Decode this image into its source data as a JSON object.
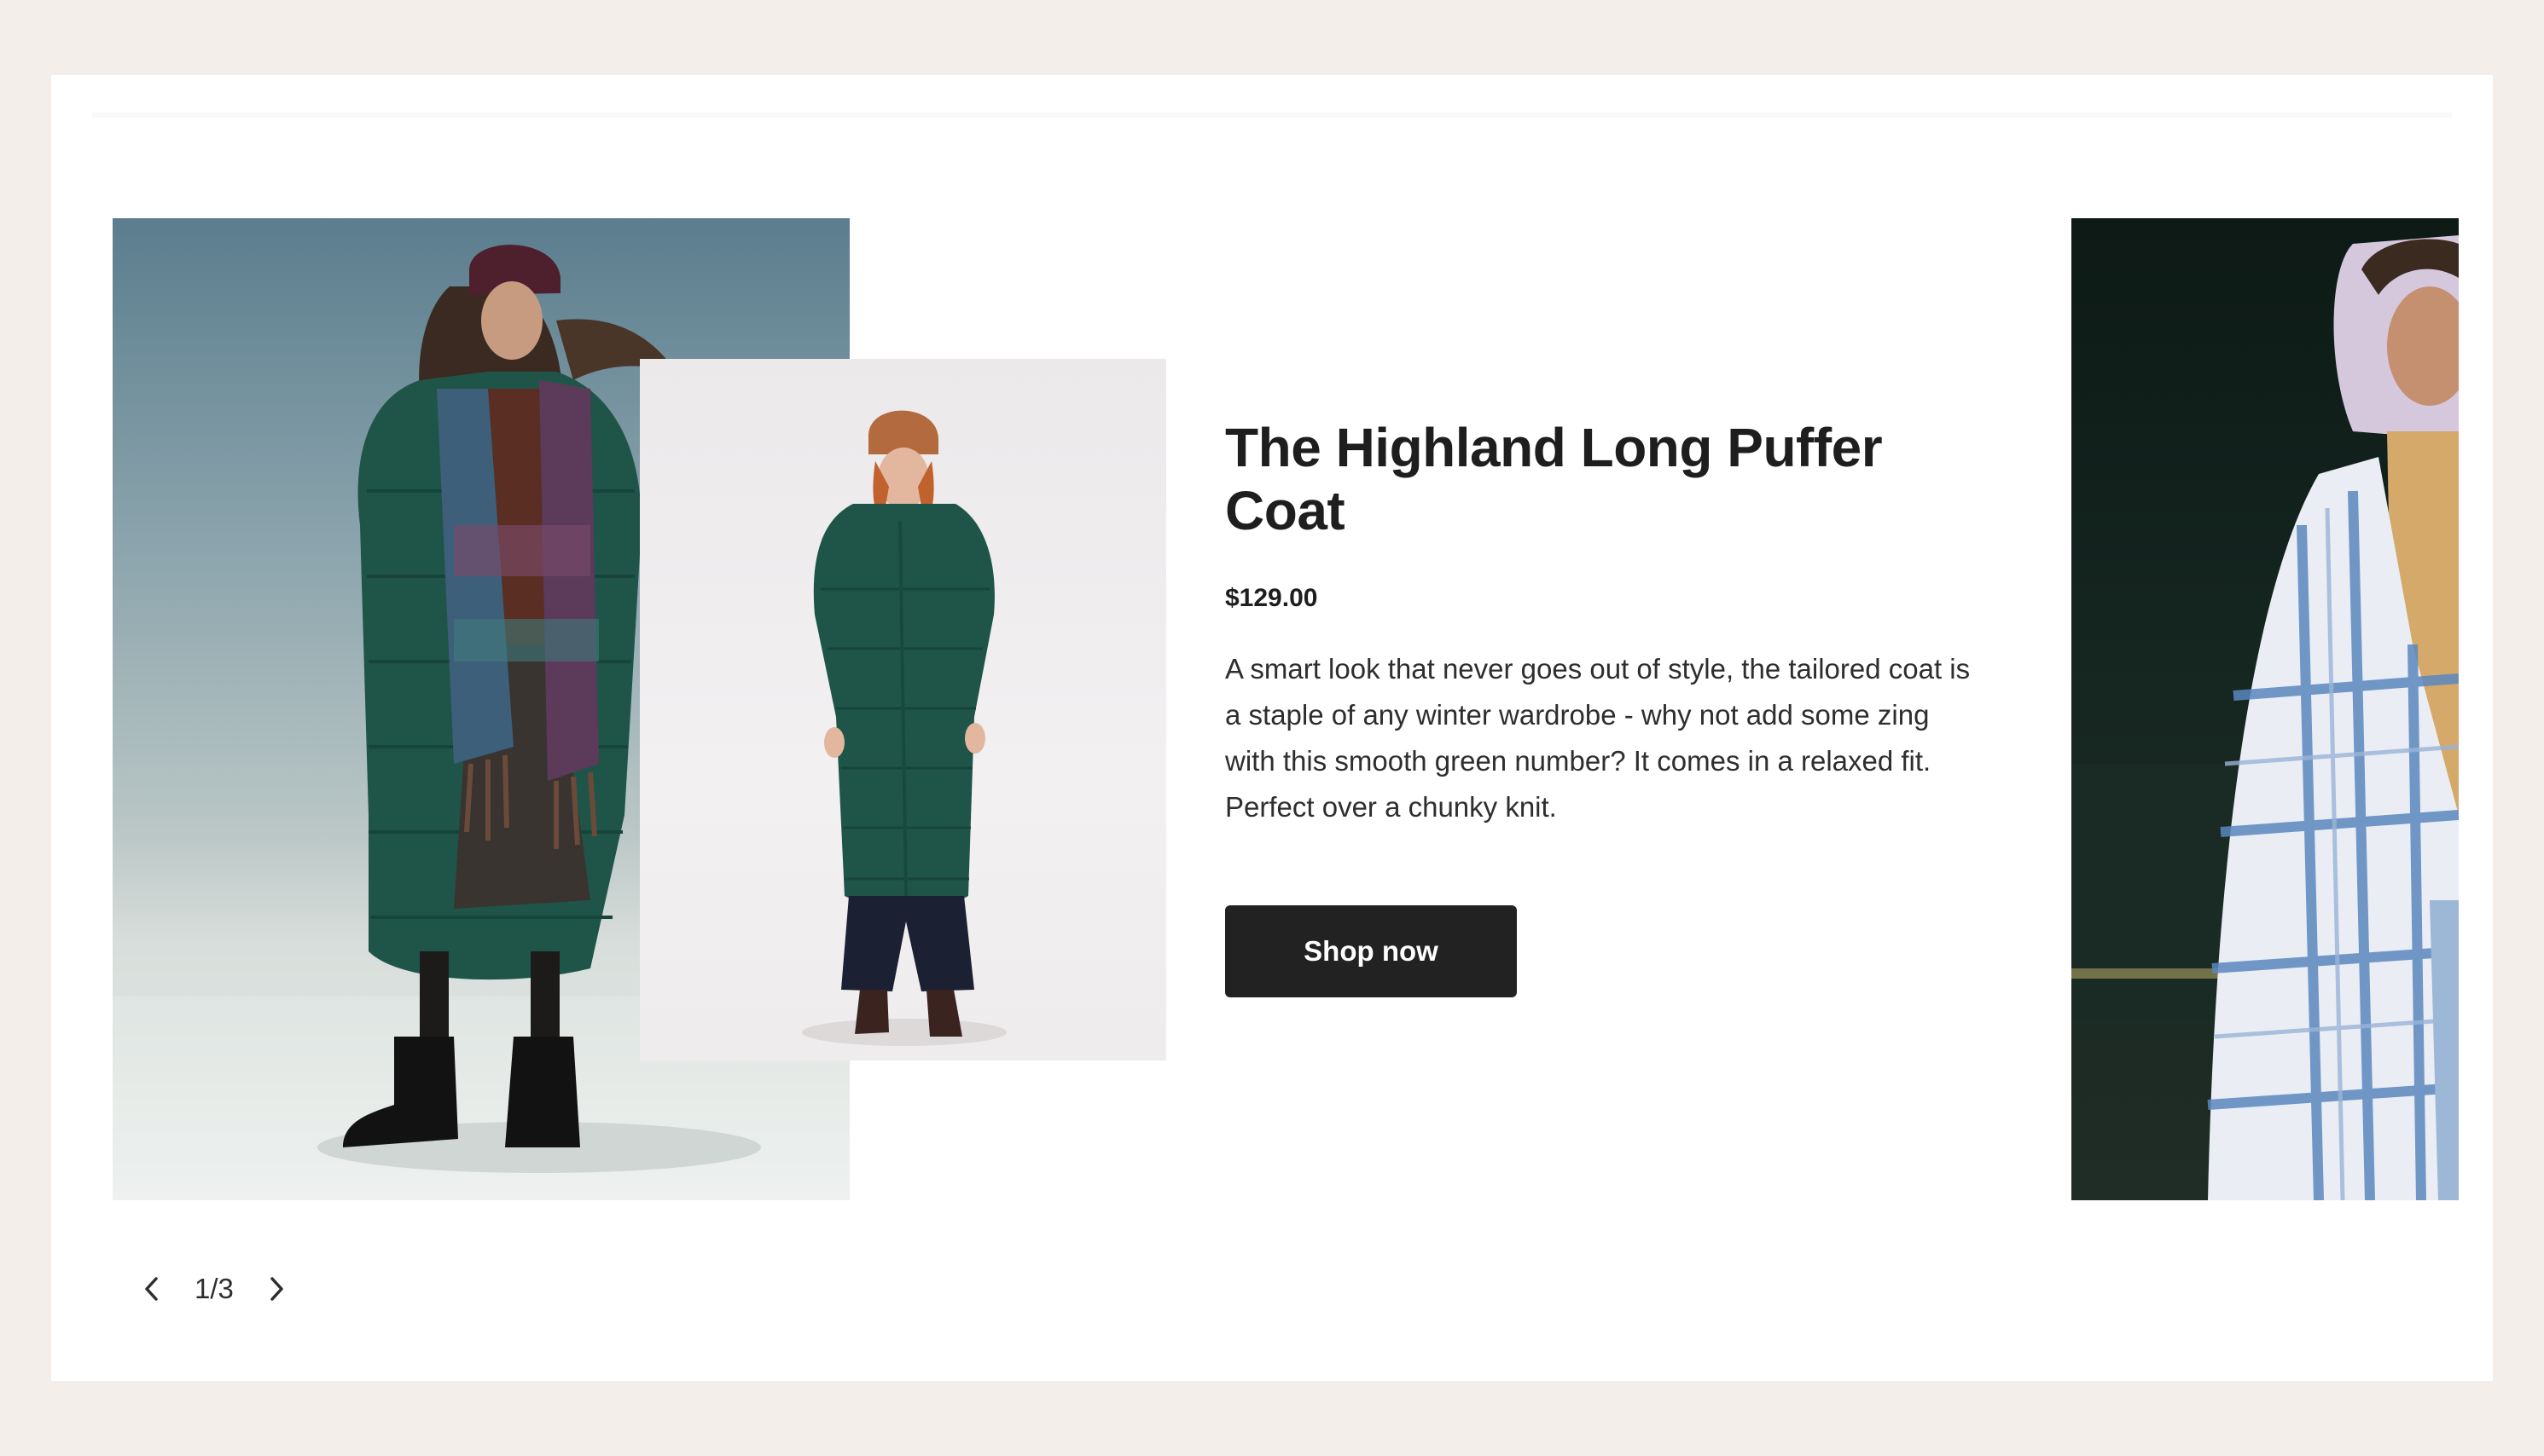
{
  "product": {
    "title": "The Highland Long Puffer Coat",
    "price": "$129.00",
    "description": "A smart look that never goes out of style, the tailored coat is a staple of any winter wardrobe - why not add some zing with this smooth green number? It comes in a relaxed fit. Perfect over a chunky knit.",
    "cta_label": "Shop now"
  },
  "pager": {
    "current": "1/3",
    "prev_icon": "chevron-left-icon",
    "next_icon": "chevron-right-icon"
  },
  "colors": {
    "page_background": "#f4eeea",
    "card_background": "#ffffff",
    "button_background": "#222222",
    "button_text": "#ffffff",
    "text": "#1e1e1e",
    "coat_green": "#1f5548"
  }
}
